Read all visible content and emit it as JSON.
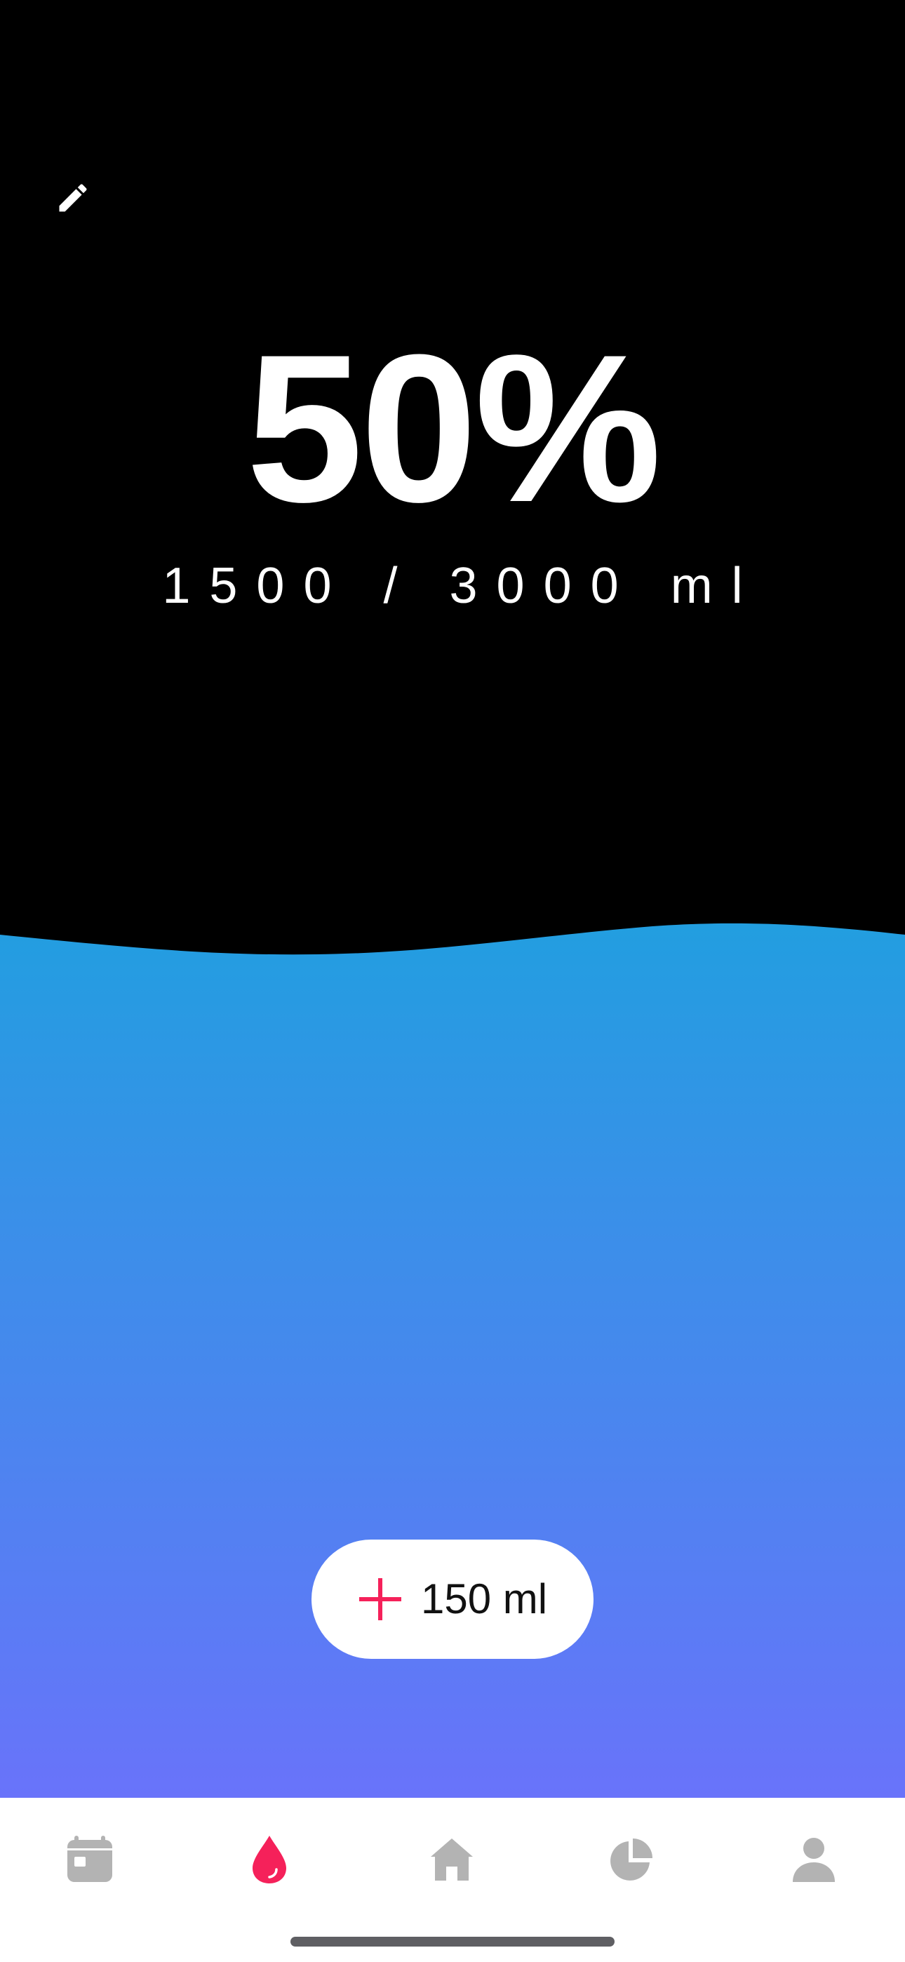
{
  "progress": {
    "percent_label": "50%",
    "fraction": 0.5,
    "amount_label": "1500 / 3000 ml"
  },
  "add_button": {
    "label": "150 ml",
    "icon": "plus-icon"
  },
  "edit_button": {
    "icon": "pencil-icon"
  },
  "tabs": [
    {
      "name": "calendar",
      "icon": "calendar-icon",
      "active": false
    },
    {
      "name": "water",
      "icon": "water-drop-icon",
      "active": true
    },
    {
      "name": "home",
      "icon": "home-icon",
      "active": false
    },
    {
      "name": "stats",
      "icon": "pie-chart-icon",
      "active": false
    },
    {
      "name": "profile",
      "icon": "person-icon",
      "active": false
    }
  ],
  "colors": {
    "background": "#000000",
    "water_top": "#229ee0",
    "water_bottom": "#6973fa",
    "accent": "#f5215a",
    "tab_inactive": "#b3b3b3",
    "tab_bar": "#ffffff"
  }
}
